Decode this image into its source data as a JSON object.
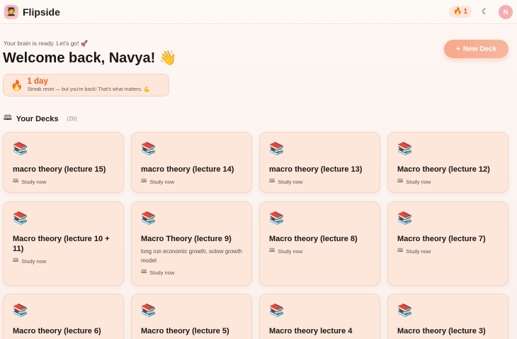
{
  "header": {
    "brand": "Flipside",
    "streak_count": "1",
    "avatar_initial": "N"
  },
  "hero": {
    "tagline": "Your brain is ready. Let's go! 🚀",
    "welcome": "Welcome back, Navya! 👋",
    "new_deck_label": "New Deck"
  },
  "streak": {
    "days": "1 day",
    "message": "Streak reset — but you're back! That's what matters. 💪"
  },
  "decks_section": {
    "label": "Your Decks",
    "count": "(26)"
  },
  "decks": [
    {
      "emoji": "📚",
      "title": "macro theory (lecture 15)",
      "desc": "",
      "study": "Study now"
    },
    {
      "emoji": "📚",
      "title": "macro theory (lecture 14)",
      "desc": "",
      "study": "Study now"
    },
    {
      "emoji": "📚",
      "title": "macro theory (lecture 13)",
      "desc": "",
      "study": "Study now"
    },
    {
      "emoji": "📚",
      "title": "Macro theory (lecture 12)",
      "desc": "",
      "study": "Study now"
    },
    {
      "emoji": "📚",
      "title": "Macro theory (lecture 10 + 11)",
      "desc": "",
      "study": "Study now"
    },
    {
      "emoji": "📚",
      "title": "Macro Theory (lecture 9)",
      "desc": "long run economic growth, solow growth model",
      "study": "Study now"
    },
    {
      "emoji": "📚",
      "title": "Macro theory (lecture 8)",
      "desc": "",
      "study": "Study now"
    },
    {
      "emoji": "📚",
      "title": "Macro theory (lecture 7)",
      "desc": "",
      "study": "Study now"
    },
    {
      "emoji": "📚",
      "title": "Macro theory (lecture 6)",
      "desc": "",
      "study": ""
    },
    {
      "emoji": "📚",
      "title": "Macro theory (lecture 5)",
      "desc": "",
      "study": ""
    },
    {
      "emoji": "📚",
      "title": "Macro theory lecture 4",
      "desc": "",
      "study": ""
    },
    {
      "emoji": "📚",
      "title": "Macro theory (lecture 3)",
      "desc": "",
      "study": ""
    }
  ],
  "colors": {
    "accent": "#f9a88a",
    "card_bg": "#fde6da",
    "streak_text": "#e8641f"
  }
}
